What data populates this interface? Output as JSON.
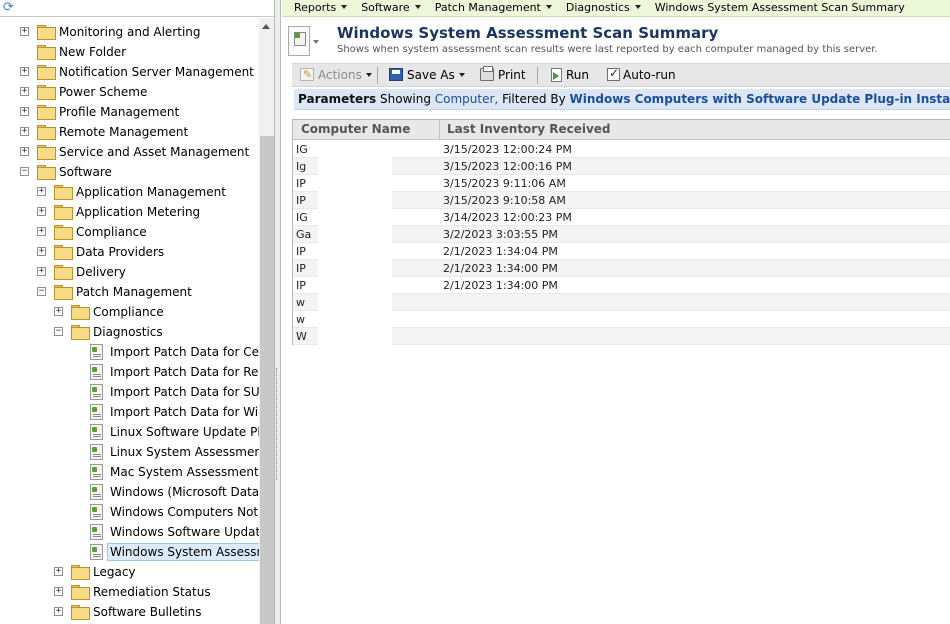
{
  "tree": {
    "items": [
      {
        "label": "Monitoring and Alerting",
        "level": 0,
        "type": "folder",
        "expander": "+"
      },
      {
        "label": "New Folder",
        "level": 0,
        "type": "folder",
        "expander": ""
      },
      {
        "label": "Notification Server Management",
        "level": 0,
        "type": "folder",
        "expander": "+"
      },
      {
        "label": "Power Scheme",
        "level": 0,
        "type": "folder",
        "expander": "+"
      },
      {
        "label": "Profile Management",
        "level": 0,
        "type": "folder",
        "expander": "+"
      },
      {
        "label": "Remote Management",
        "level": 0,
        "type": "folder",
        "expander": "+"
      },
      {
        "label": "Service and Asset Management",
        "level": 0,
        "type": "folder",
        "expander": "+"
      },
      {
        "label": "Software",
        "level": 0,
        "type": "folder",
        "expander": "−"
      },
      {
        "label": "Application Management",
        "level": 1,
        "type": "folder",
        "expander": "+"
      },
      {
        "label": "Application Metering",
        "level": 1,
        "type": "folder",
        "expander": "+"
      },
      {
        "label": "Compliance",
        "level": 1,
        "type": "folder",
        "expander": "+"
      },
      {
        "label": "Data Providers",
        "level": 1,
        "type": "folder",
        "expander": "+"
      },
      {
        "label": "Delivery",
        "level": 1,
        "type": "folder",
        "expander": "+"
      },
      {
        "label": "Patch Management",
        "level": 1,
        "type": "folder",
        "expander": "−"
      },
      {
        "label": "Compliance",
        "level": 2,
        "type": "folder",
        "expander": "+"
      },
      {
        "label": "Diagnostics",
        "level": 2,
        "type": "folder",
        "expander": "−"
      },
      {
        "label": "Import Patch Data for Cent",
        "level": 3,
        "type": "report",
        "expander": ""
      },
      {
        "label": "Import Patch Data for Red",
        "level": 3,
        "type": "report",
        "expander": ""
      },
      {
        "label": "Import Patch Data for SUS",
        "level": 3,
        "type": "report",
        "expander": ""
      },
      {
        "label": "Import Patch Data for Winc",
        "level": 3,
        "type": "report",
        "expander": ""
      },
      {
        "label": "Linux Software Update Plug",
        "level": 3,
        "type": "report",
        "expander": ""
      },
      {
        "label": "Linux System Assessment",
        "level": 3,
        "type": "report",
        "expander": ""
      },
      {
        "label": "Mac System Assessment S",
        "level": 3,
        "type": "report",
        "expander": ""
      },
      {
        "label": "Windows (Microsoft Data) I",
        "level": 3,
        "type": "report",
        "expander": ""
      },
      {
        "label": "Windows Computers Not R",
        "level": 3,
        "type": "report",
        "expander": ""
      },
      {
        "label": "Windows Software Update",
        "level": 3,
        "type": "report",
        "expander": ""
      },
      {
        "label": "Windows System Assessme",
        "level": 3,
        "type": "report",
        "expander": "",
        "selected": true
      },
      {
        "label": "Legacy",
        "level": 2,
        "type": "folder",
        "expander": "+"
      },
      {
        "label": "Remediation Status",
        "level": 2,
        "type": "folder",
        "expander": "+"
      },
      {
        "label": "Software Bulletins",
        "level": 2,
        "type": "folder",
        "expander": "+"
      }
    ]
  },
  "breadcrumb": [
    {
      "label": "Reports",
      "dropdown": true
    },
    {
      "label": "Software",
      "dropdown": true
    },
    {
      "label": "Patch Management",
      "dropdown": true
    },
    {
      "label": "Diagnostics",
      "dropdown": true
    },
    {
      "label": "Windows System Assessment Scan Summary",
      "dropdown": false
    }
  ],
  "header": {
    "title": "Windows System Assessment Scan Summary",
    "description": "Shows when system assessment scan results were last reported by each computer managed by this server."
  },
  "toolbar": {
    "actions_label": "Actions",
    "save_as_label": "Save As",
    "print_label": "Print",
    "run_label": "Run",
    "autorun_label": "Auto-run",
    "autorun_checked": true
  },
  "parameters": {
    "label": "Parameters",
    "showing": "Showing",
    "entity": "Computer,",
    "filtered_by": "Filtered By",
    "filter": "Windows Computers with Software Update Plug-in Installed"
  },
  "grid": {
    "columns": [
      "Computer Name",
      "Last Inventory Received"
    ],
    "rows": [
      {
        "name": "IG",
        "date": "3/15/2023 12:00:24 PM"
      },
      {
        "name": "Ig",
        "date": "3/15/2023 12:00:16 PM"
      },
      {
        "name": "IP",
        "date": "3/15/2023 9:11:06 AM"
      },
      {
        "name": "IP",
        "date": "3/15/2023 9:10:58 AM"
      },
      {
        "name": "IG",
        "date": "3/14/2023 12:00:23 PM"
      },
      {
        "name": "Ga",
        "date": "3/2/2023 3:03:55 PM"
      },
      {
        "name": "IP",
        "date": "2/1/2023 1:34:04 PM"
      },
      {
        "name": "IP",
        "date": "2/1/2023 1:34:00 PM"
      },
      {
        "name": "IP",
        "date": "2/1/2023 1:34:00 PM"
      },
      {
        "name": "w",
        "date": ""
      },
      {
        "name": "w",
        "date": ""
      },
      {
        "name": "W",
        "date": ""
      }
    ]
  },
  "colors": {
    "breadcrumb_bg": "#ecf7d9",
    "params_bg": "#dde7f3",
    "title_color": "#1c355e",
    "link_color": "#1a4f9c",
    "selected_bg": "#dcebfc"
  },
  "icons": {
    "refresh": "refresh-icon",
    "folder": "folder-icon",
    "report": "report-icon",
    "actions": "pencil-icon",
    "save": "disk-icon",
    "print": "printer-icon",
    "run": "run-icon"
  }
}
